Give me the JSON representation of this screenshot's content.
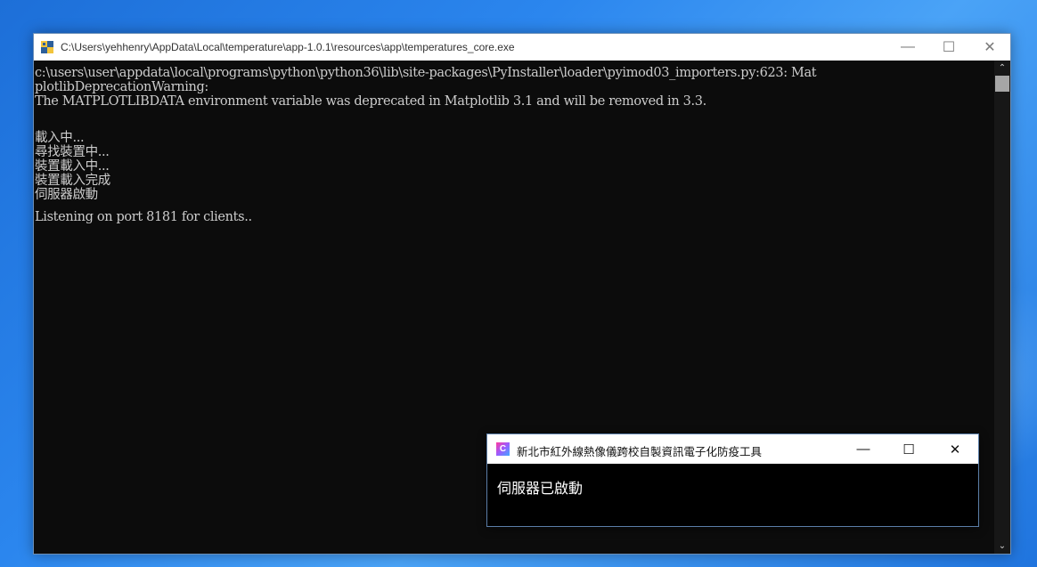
{
  "console_window": {
    "title": "C:\\Users\\yehhenry\\AppData\\Local\\temperature\\app-1.0.1\\resources\\app\\temperatures_core.exe",
    "minimize_glyph": "—",
    "maximize_glyph": "☐",
    "close_glyph": "✕",
    "lines": [
      "c:\\users\\user\\appdata\\local\\programs\\python\\python36\\lib\\site-packages\\PyInstaller\\loader\\pyimod03_importers.py:623: Mat",
      "plotlibDeprecationWarning:",
      "The MATPLOTLIBDATA environment variable was deprecated in Matplotlib 3.1 and will be removed in 3.3.",
      "",
      "載入中...",
      "尋找裝置中...",
      "裝置載入中...",
      "裝置載入完成",
      "伺服器啟動",
      "Listening on port 8181 for clients.."
    ],
    "scroll_up_glyph": "⌃",
    "scroll_down_glyph": "⌄"
  },
  "app_window": {
    "title": "新北市紅外線熱像儀跨校自製資訊電子化防疫工具",
    "icon_letter": "C",
    "minimize_glyph": "—",
    "maximize_glyph": "☐",
    "close_glyph": "✕",
    "status_text": "伺服器已啟動"
  },
  "colors": {
    "console_bg": "#0c0c0c",
    "console_text": "#cccccc",
    "desktop_blue": "#1d6fd8"
  }
}
